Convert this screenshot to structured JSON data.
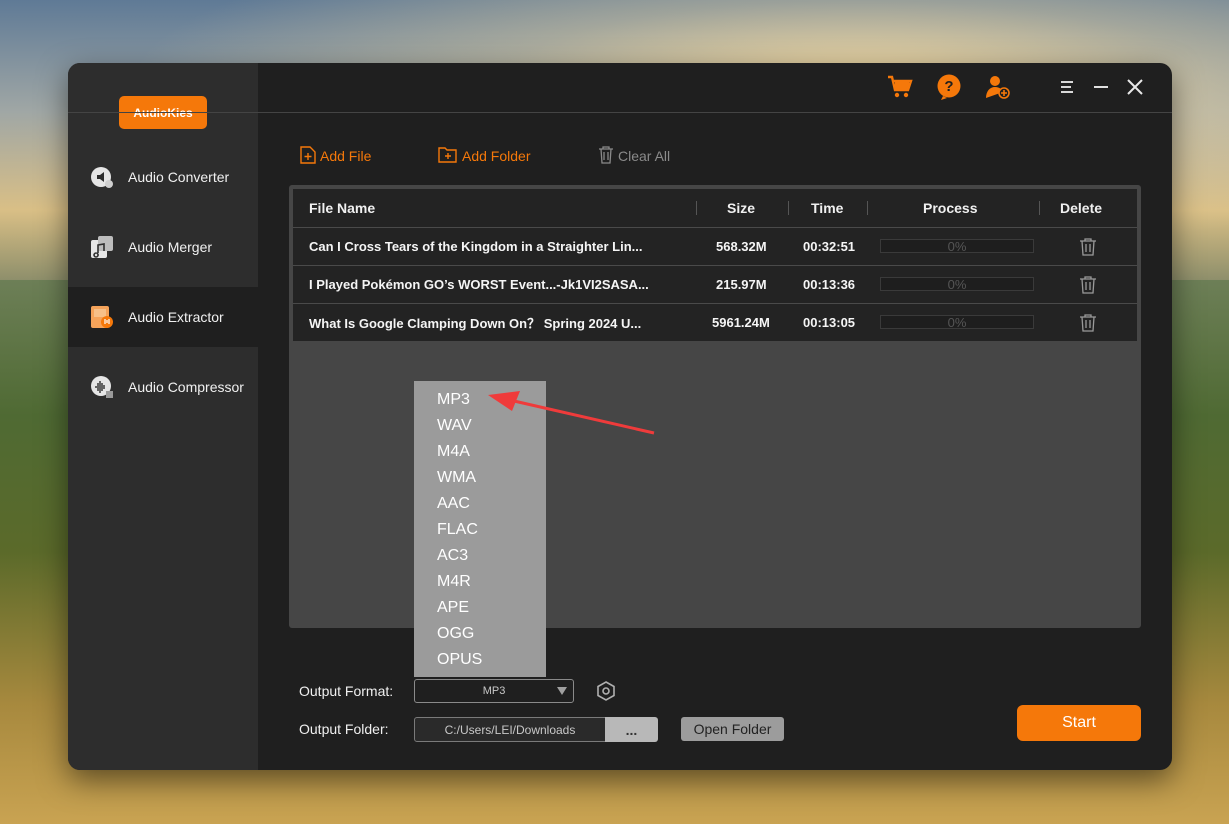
{
  "app": {
    "brand": "AudioKies"
  },
  "colors": {
    "accent": "#f5780a",
    "window_bg": "#1f1f1f",
    "sidebar_bg": "#2d2d2d"
  },
  "topbar": {
    "icons": [
      "cart-icon",
      "help-icon",
      "user-add-icon",
      "menu-icon",
      "minimize-icon",
      "close-icon"
    ]
  },
  "sidebar": {
    "items": [
      {
        "label": "Audio Converter",
        "icon": "audio-converter-icon",
        "active": false
      },
      {
        "label": "Audio Merger",
        "icon": "audio-merger-icon",
        "active": false
      },
      {
        "label": "Audio Extractor",
        "icon": "audio-extractor-icon",
        "active": true
      },
      {
        "label": "Audio Compressor",
        "icon": "audio-compressor-icon",
        "active": false
      }
    ]
  },
  "toolbar": {
    "add_file": "Add File",
    "add_folder": "Add Folder",
    "clear_all": "Clear All"
  },
  "table": {
    "headers": {
      "file_name": "File Name",
      "size": "Size",
      "time": "Time",
      "process": "Process",
      "delete": "Delete"
    },
    "rows": [
      {
        "name": "Can I Cross Tears of the Kingdom in a Straighter Lin...",
        "size": "568.32M",
        "time": "00:32:51",
        "progress": "0%"
      },
      {
        "name": "I Played Pokémon GO’s WORST Event...-Jk1VI2SASA...",
        "size": "215.97M",
        "time": "00:13:36",
        "progress": "0%"
      },
      {
        "name": "What Is Google Clamping Down On？ Spring 2024 U...",
        "size": "5961.24M",
        "time": "00:13:05",
        "progress": "0%"
      }
    ]
  },
  "format_dropdown": {
    "options": [
      "MP3",
      "WAV",
      "M4A",
      "WMA",
      "AAC",
      "FLAC",
      "AC3",
      "M4R",
      "APE",
      "OGG",
      "OPUS"
    ]
  },
  "output": {
    "format_label": "Output Format:",
    "format_value": "MP3",
    "folder_label": "Output Folder:",
    "folder_value": "C:/Users/LEI/Downloads",
    "browse_label": "...",
    "open_folder": "Open Folder",
    "start": "Start"
  }
}
